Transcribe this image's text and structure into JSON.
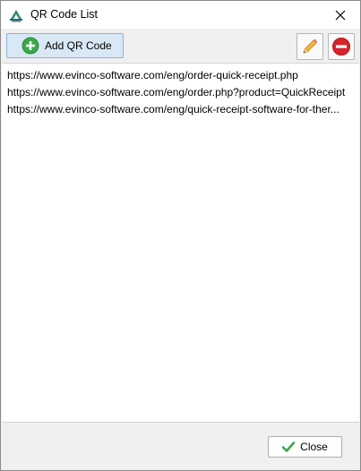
{
  "window": {
    "title": "QR Code List"
  },
  "toolbar": {
    "add_label": "Add QR Code",
    "add_icon": "plus-circle-icon",
    "edit_icon": "pencil-icon",
    "remove_icon": "minus-circle-icon"
  },
  "list": {
    "items": [
      "https://www.evinco-software.com/eng/order-quick-receipt.php",
      "https://www.evinco-software.com/eng/order.php?product=QuickReceipt",
      "https://www.evinco-software.com/eng/quick-receipt-software-for-ther..."
    ]
  },
  "footer": {
    "close_label": "Close",
    "close_icon": "checkmark-icon"
  },
  "colors": {
    "accent_green": "#3aa84a",
    "remove_red": "#d8232a",
    "add_button_bg": "#d9e8f5",
    "add_button_border": "#8fb3d9"
  }
}
